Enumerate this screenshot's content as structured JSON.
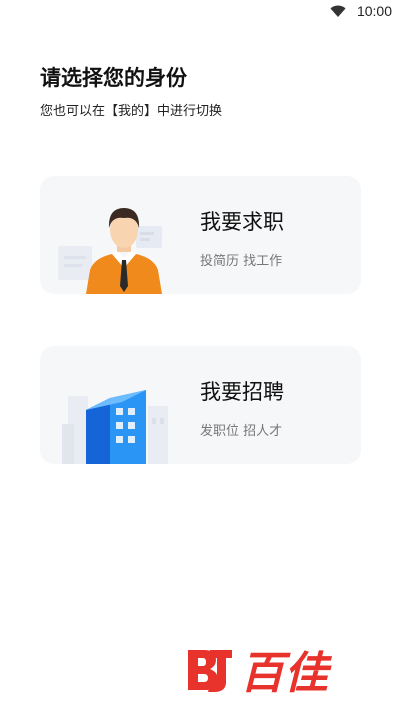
{
  "status_bar": {
    "time": "10:00",
    "wifi_icon": "wifi-icon"
  },
  "header": {
    "title": "请选择您的身份",
    "subtitle": "您也可以在【我的】中进行切换"
  },
  "roles": [
    {
      "heading": "我要求职",
      "description": "投简历 找工作",
      "icon": "job-seeker-avatar-icon"
    },
    {
      "heading": "我要招聘",
      "description": "发职位 招人才",
      "icon": "building-icon"
    }
  ],
  "brand": {
    "logo_text": "百佳",
    "accent": "#e8322c"
  },
  "colors": {
    "card_bg": "#f6f7f9",
    "avatar_shirt": "#f08a1c",
    "building_blue": "#1e88f5"
  }
}
